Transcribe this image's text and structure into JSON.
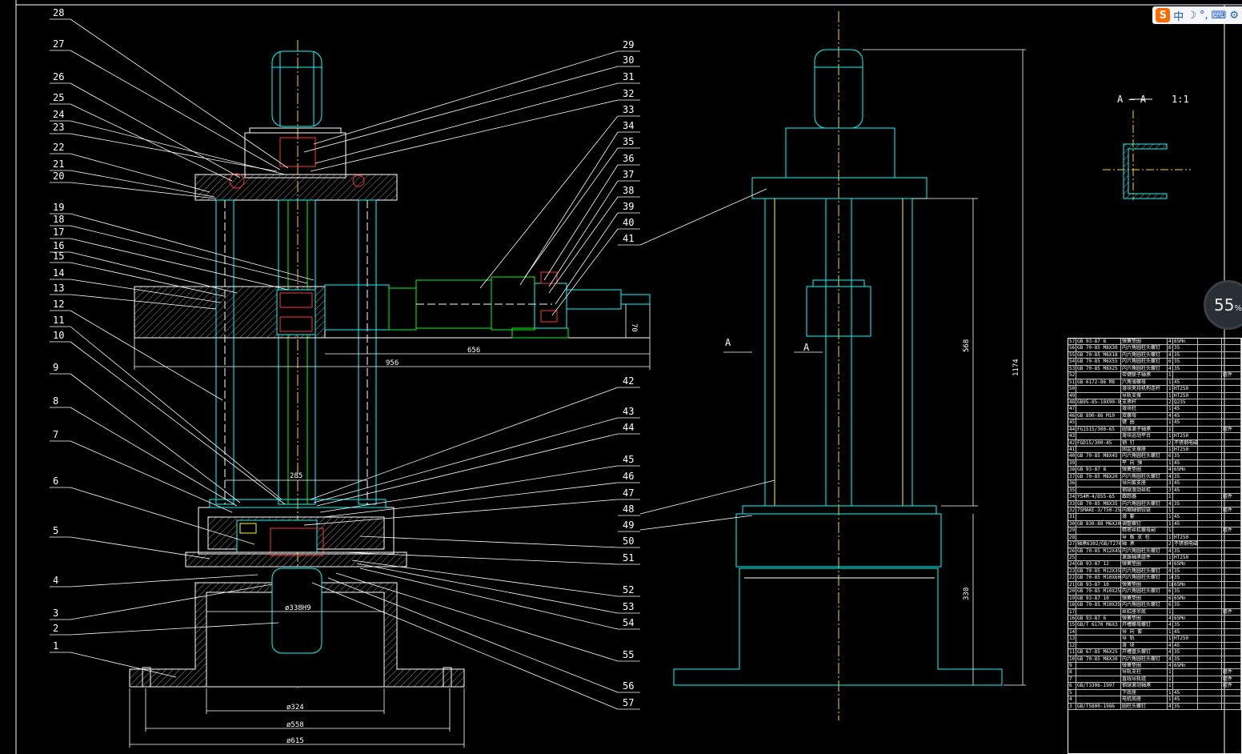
{
  "drawing": {
    "part_labels_left": [
      "28",
      "27",
      "26",
      "25",
      "24",
      "23",
      "22",
      "21",
      "20",
      "19",
      "18",
      "17",
      "16",
      "15",
      "14",
      "13",
      "12",
      "11",
      "10",
      "9",
      "8",
      "7",
      "6",
      "5",
      "4",
      "3",
      "2",
      "1"
    ],
    "part_labels_right": [
      "29",
      "30",
      "31",
      "32",
      "33",
      "34",
      "35",
      "36",
      "37",
      "38",
      "39",
      "40",
      "41",
      "42",
      "43",
      "44",
      "45",
      "46",
      "47",
      "48",
      "49",
      "50",
      "51",
      "52",
      "53",
      "54",
      "55",
      "56",
      "57"
    ],
    "dimensions": {
      "d656": "656",
      "d956": "956",
      "d70": "70",
      "d285": "285",
      "bore": "ø338H9",
      "d324": "ø324",
      "d558": "ø558",
      "d615": "ø615",
      "h568": "568",
      "h1174": "1174",
      "h330": "330"
    },
    "section_marks": {
      "a_left": "A",
      "a_right": "A",
      "section_title": "A — A",
      "section_scale": "1:1"
    }
  },
  "ime_toolbar": {
    "logo": "S",
    "mode": "中",
    "icons": [
      "moon-icon",
      "punctuation-icon",
      "keyboard-icon",
      "settings-icon"
    ]
  },
  "zoom_gauge": {
    "value": "55",
    "unit": "%"
  },
  "bom": {
    "rows": [
      [
        "57",
        "GB 93-87 8",
        "弹簧垫圈",
        "4",
        "65Mn",
        "",
        ""
      ],
      [
        "56",
        "GB 70-85 M8X30",
        "内六角圆柱头螺钉",
        "6",
        "35",
        "",
        ""
      ],
      [
        "55",
        "GB 70-85 M6X18",
        "内六角圆柱头螺钉",
        "4",
        "35",
        "",
        ""
      ],
      [
        "54",
        "GB 70-85 M6X55",
        "内六角圆柱头螺钉",
        "6",
        "35",
        "",
        ""
      ],
      [
        "53",
        "GB 70-85 M8X25",
        "内六角圆柱头螺钉",
        "4",
        "35",
        "",
        ""
      ],
      [
        "52",
        "",
        "带键联子轴承",
        "1",
        "",
        "",
        "组件"
      ],
      [
        "51",
        "GB 6172-86 M8",
        "六角薄螺母",
        "1",
        "45",
        "",
        ""
      ],
      [
        "50",
        "",
        "滑块夹持机构连杆",
        "1",
        "HT250",
        "",
        ""
      ],
      [
        "49",
        "",
        "导轨支撑",
        "1",
        "HT250",
        "",
        ""
      ],
      [
        "48",
        "GB95-85-10X90-95",
        "支承杆",
        "2",
        "Q235",
        "",
        ""
      ],
      [
        "47",
        "",
        "滑块柱",
        "1",
        "45",
        "",
        ""
      ],
      [
        "46",
        "GB 890-86 M10",
        "双螺母",
        "4",
        "45",
        "",
        ""
      ],
      [
        "45",
        "",
        "键 圈",
        "1",
        "45",
        "",
        ""
      ],
      [
        "44",
        "FG1515/300-65",
        "圆锥滚子轴承",
        "1",
        "",
        "",
        "组件"
      ],
      [
        "43",
        "",
        "滑块运动平台",
        "1",
        "HT250",
        "",
        ""
      ],
      [
        "42",
        "FGD15/300-45",
        "销 钉",
        "2",
        "不锈钢电磁",
        "",
        ""
      ],
      [
        "41",
        "",
        "固定支撑座",
        "1",
        "HT250",
        "",
        ""
      ],
      [
        "40",
        "GB 70-85 M8X45",
        "内六角圆柱头螺钉",
        "6",
        "35",
        "",
        ""
      ],
      [
        "39",
        "",
        "平 向 弹",
        "1",
        "45",
        "",
        ""
      ],
      [
        "38",
        "GB 93-87 8",
        "弹簧垫圈",
        "4",
        "65Mn",
        "",
        ""
      ],
      [
        "37",
        "GB 70-85 M8X20",
        "内六角圆柱头螺钉",
        "4",
        "35",
        "",
        ""
      ],
      [
        "36",
        "",
        "导向套支座",
        "3",
        "45",
        "",
        ""
      ],
      [
        "35",
        "",
        "钢球滑动丝杠",
        "3",
        "45",
        "",
        ""
      ],
      [
        "34",
        "YS4M-4/D55-65",
        "跟踪器",
        "1",
        "",
        "",
        "组件"
      ],
      [
        "33",
        "GB 70-85 M8X35",
        "内六角圆柱头螺钉",
        "4",
        "35",
        "",
        ""
      ],
      [
        "32",
        "7SMAKE-3/T50-25",
        "内缩轴钢铰链",
        "1",
        "",
        "",
        "组件"
      ],
      [
        "31",
        "",
        "滑 套",
        "1",
        "45",
        "",
        ""
      ],
      [
        "30",
        "GB 830-88 M6X20",
        "调整螺钉",
        "1",
        "45",
        "",
        ""
      ],
      [
        "29",
        "",
        "精密丝杠螺母副",
        "1",
        "",
        "",
        "组件"
      ],
      [
        "28",
        "",
        "导 板 支 柱",
        "1",
        "HT250",
        "",
        ""
      ],
      [
        "27",
        "轴承6302/GB/T276",
        "轴 承",
        "2",
        "不锈钢电磁",
        "",
        ""
      ],
      [
        "26",
        "GB 70-85 M12X45",
        "内六角圆柱头螺钉",
        "4",
        "35",
        "",
        ""
      ],
      [
        "25",
        "",
        "滚珠轴承组件",
        "1",
        "HT250",
        "",
        ""
      ],
      [
        "24",
        "GB 93-87 12",
        "弹簧垫圈",
        "4",
        "65Mn",
        "",
        ""
      ],
      [
        "23",
        "GB 70-85 M12X35",
        "内六角圆柱头螺钉",
        "4",
        "35",
        "",
        ""
      ],
      [
        "22",
        "GB 70-85 M10X60",
        "内六角圆柱头螺钉",
        "16",
        "35",
        "",
        ""
      ],
      [
        "21",
        "GB 93-87 10",
        "弹簧垫圈",
        "16",
        "65Mn",
        "",
        ""
      ],
      [
        "20",
        "GB 70-85 M10X25",
        "内六角圆柱头螺钉",
        "6",
        "35",
        "",
        ""
      ],
      [
        "19",
        "GB 93-87 10",
        "弹簧垫圈",
        "6",
        "65Mn",
        "",
        ""
      ],
      [
        "18",
        "GB 70-85 M10X35",
        "内六角圆柱头螺钉",
        "6",
        "35",
        "",
        ""
      ],
      [
        "17",
        "",
        "丝杠座半底",
        "1",
        "",
        "",
        "组件"
      ],
      [
        "16",
        "GB 93-87 6",
        "弹簧垫圈",
        "4",
        "65Mn",
        "",
        ""
      ],
      [
        "15",
        "GB/T 6170 M6X3",
        "开槽螺母螺钉",
        "4",
        "35",
        "",
        ""
      ],
      [
        "14",
        "",
        "导 向 套",
        "1",
        "45",
        "",
        ""
      ],
      [
        "13",
        "",
        "导 轨",
        "1",
        "HT250",
        "",
        ""
      ],
      [
        "12",
        "",
        "滑 块",
        "4",
        "45",
        "",
        ""
      ],
      [
        "11",
        "GB 67-85 M6X25",
        "开槽盘头螺钉",
        "4",
        "35",
        "",
        ""
      ],
      [
        "10",
        "GB 70-85 M8X30",
        "内六角圆柱头螺钉",
        "4",
        "35",
        "",
        ""
      ],
      [
        "9",
        "",
        "弹簧垫圈",
        "4",
        "65Mn",
        "",
        ""
      ],
      [
        "8",
        "",
        "导轨支柱",
        "1",
        "",
        "",
        "组件"
      ],
      [
        "7",
        "",
        "直线导轨组",
        "1",
        "",
        "",
        "组件"
      ],
      [
        "6",
        "GB/T3306-1997",
        "钢球滚动轴承",
        "1",
        "",
        "",
        "组件"
      ],
      [
        "5",
        "",
        "下底座",
        "1",
        "45",
        "",
        ""
      ],
      [
        "4",
        "",
        "电机底座",
        "1",
        "45",
        "",
        ""
      ],
      [
        "3",
        "GB/T5800-1986",
        "圆柱头螺钉",
        "4",
        "35",
        "",
        ""
      ]
    ]
  }
}
